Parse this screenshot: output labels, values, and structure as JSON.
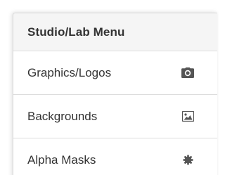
{
  "menu": {
    "title": "Studio/Lab Menu",
    "items": [
      {
        "label": "Graphics/Logos",
        "icon": "camera-icon"
      },
      {
        "label": "Backgrounds",
        "icon": "picture-icon"
      },
      {
        "label": "Alpha Masks",
        "icon": "gear-icon"
      }
    ]
  },
  "colors": {
    "header_background": "#f5f5f5",
    "border": "#dddddd",
    "text": "#333333",
    "icon": "#555555"
  }
}
